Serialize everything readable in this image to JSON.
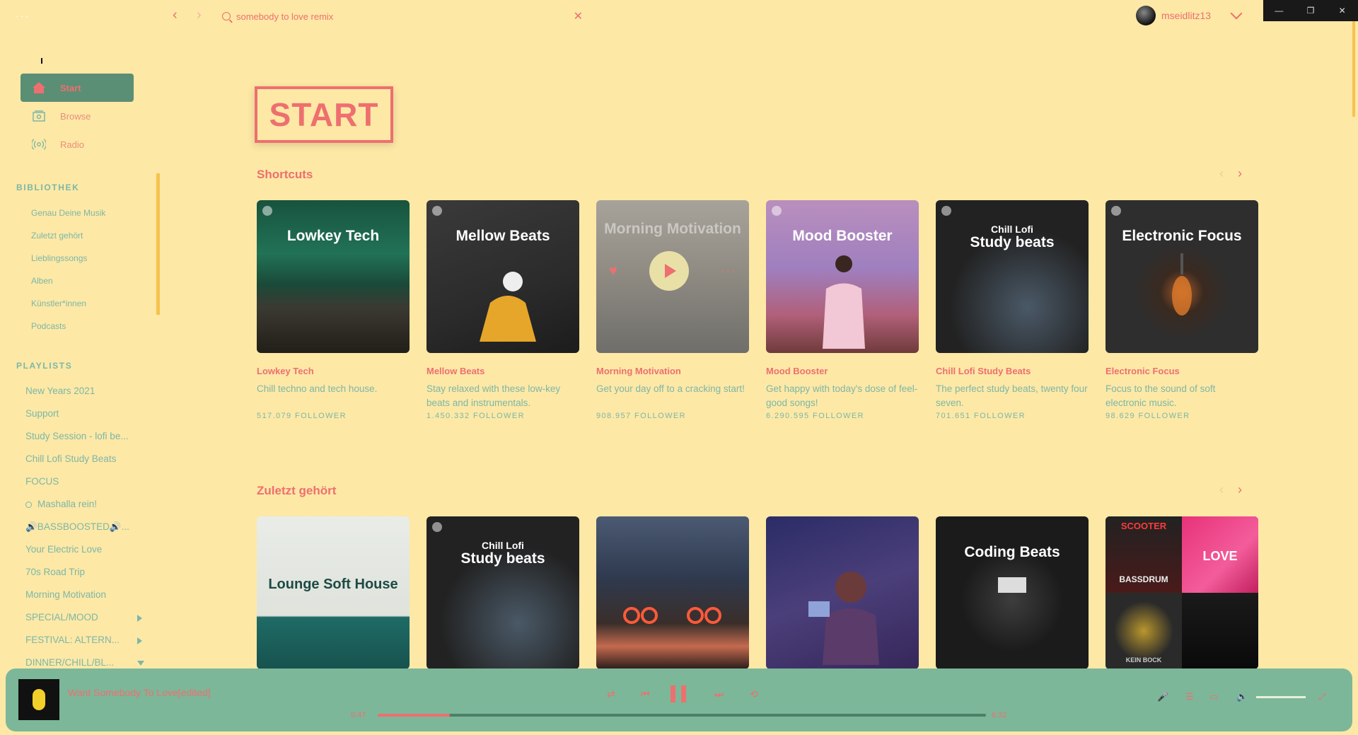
{
  "window": {
    "controls": [
      "minimize",
      "restore",
      "close"
    ]
  },
  "topbar": {
    "menu_dots": "···",
    "search_value": "somebody to love remix",
    "username": "mseidlitz13"
  },
  "sidebar": {
    "nav": [
      {
        "label": "Start",
        "icon": "home-icon",
        "active": true
      },
      {
        "label": "Browse",
        "icon": "browse-icon",
        "active": false
      },
      {
        "label": "Radio",
        "icon": "radio-icon",
        "active": false
      }
    ],
    "library_heading": "BIBLIOTHEK",
    "library": [
      "Genau Deine Musik",
      "Zuletzt gehört",
      "Lieblingssongs",
      "Alben",
      "Künstler*innen",
      "Podcasts"
    ],
    "playlists_heading": "PLAYLISTS",
    "playlists": [
      "New Years 2021",
      "Support",
      "Study Session - lofi be...",
      "Chill Lofi Study Beats",
      "FOCUS",
      "Mashalla rein!",
      "🔊BASSBOOSTED🔊...",
      "Your Electric Love",
      "70s Road Trip",
      "Morning Motivation",
      "SPECIAL/MOOD",
      "FESTIVAL: ALTERN...",
      "DINNER/CHILL/BL..."
    ]
  },
  "main": {
    "page_title": "START",
    "shortcuts_title": "Shortcuts",
    "shortcuts": [
      {
        "cover_title": "Lowkey Tech",
        "cover_small": "",
        "name": "Lowkey Tech",
        "desc": "Chill techno and tech house.",
        "followers": "517.079 FOLLOWER"
      },
      {
        "cover_title": "Mellow Beats",
        "cover_small": "",
        "name": "Mellow Beats",
        "desc": "Stay relaxed with these low-key beats and instrumentals.",
        "followers": "1.450.332 FOLLOWER"
      },
      {
        "cover_title": "Morning Motivation",
        "cover_small": "",
        "name": "Morning Motivation",
        "desc": "Get your day off to a cracking start!",
        "followers": "908.957 FOLLOWER"
      },
      {
        "cover_title": "Mood Booster",
        "cover_small": "",
        "name": "Mood Booster",
        "desc": "Get happy with today's dose of feel-good songs!",
        "followers": "6.290.595 FOLLOWER"
      },
      {
        "cover_title": "Study beats",
        "cover_small": "Chill Lofi",
        "name": "Chill Lofi Study Beats",
        "desc": "The perfect study beats, twenty four seven.",
        "followers": "701.651 FOLLOWER"
      },
      {
        "cover_title": "Electronic Focus",
        "cover_small": "",
        "name": "Electronic Focus",
        "desc": "Focus to the sound of soft electronic music.",
        "followers": "98.629 FOLLOWER"
      }
    ],
    "recent_title": "Zuletzt gehört",
    "recent": [
      {
        "cover_title": "Lounge Soft House",
        "cover_small": ""
      },
      {
        "cover_title": "Study beats",
        "cover_small": "Chill Lofi"
      },
      {
        "cover_title": "",
        "cover_small": ""
      },
      {
        "cover_title": "",
        "cover_small": ""
      },
      {
        "cover_title": "Coding Beats",
        "cover_small": ""
      },
      {
        "cover_title": "",
        "cover_small": "",
        "mosaic_labels": [
          "SCOOTER",
          "BASSDRUM",
          "LOVE",
          "KEIN BOCK"
        ]
      }
    ]
  },
  "player": {
    "track_title": "Want Somebody To Love[edited]",
    "elapsed": "0:47",
    "duration": "6:32",
    "progress": 0.119,
    "volume": 0.8,
    "accent": "#ee6f6f",
    "bar_color": "#7cb799"
  }
}
